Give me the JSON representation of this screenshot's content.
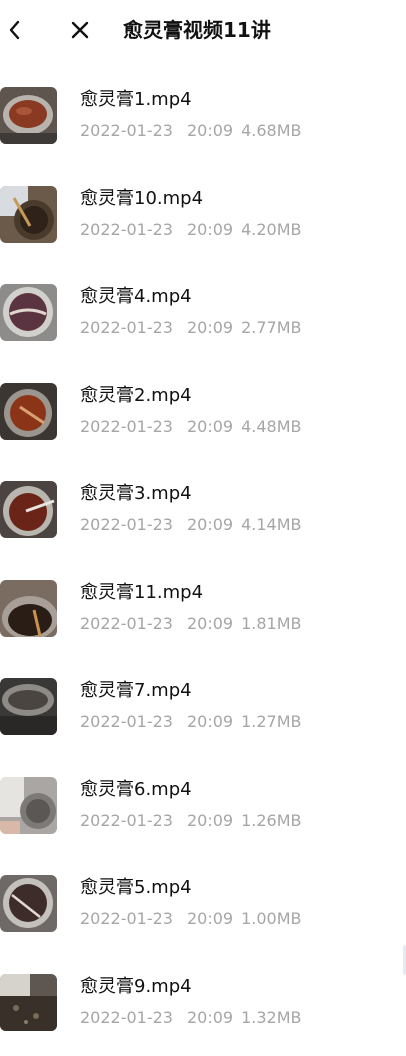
{
  "header": {
    "title": "愈灵膏视频11讲",
    "back_icon": "chevron-left-icon",
    "close_icon": "close-icon"
  },
  "files": [
    {
      "name": "愈灵膏1.mp4",
      "date": "2022-01-23",
      "time": "20:09",
      "size": "4.68MB"
    },
    {
      "name": "愈灵膏10.mp4",
      "date": "2022-01-23",
      "time": "20:09",
      "size": "4.20MB"
    },
    {
      "name": "愈灵膏4.mp4",
      "date": "2022-01-23",
      "time": "20:09",
      "size": "2.77MB"
    },
    {
      "name": "愈灵膏2.mp4",
      "date": "2022-01-23",
      "time": "20:09",
      "size": "4.48MB"
    },
    {
      "name": "愈灵膏3.mp4",
      "date": "2022-01-23",
      "time": "20:09",
      "size": "4.14MB"
    },
    {
      "name": "愈灵膏11.mp4",
      "date": "2022-01-23",
      "time": "20:09",
      "size": "1.81MB"
    },
    {
      "name": "愈灵膏7.mp4",
      "date": "2022-01-23",
      "time": "20:09",
      "size": "1.27MB"
    },
    {
      "name": "愈灵膏6.mp4",
      "date": "2022-01-23",
      "time": "20:09",
      "size": "1.26MB"
    },
    {
      "name": "愈灵膏5.mp4",
      "date": "2022-01-23",
      "time": "20:09",
      "size": "1.00MB"
    },
    {
      "name": "愈灵膏9.mp4",
      "date": "2022-01-23",
      "time": "20:09",
      "size": "1.32MB"
    }
  ],
  "colors": {
    "title": "#111111",
    "meta": "#a6a6a6",
    "background": "#ffffff"
  }
}
